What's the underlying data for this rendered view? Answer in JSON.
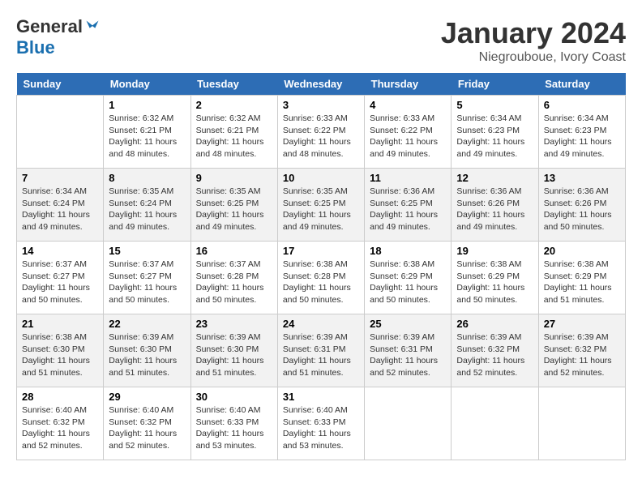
{
  "logo": {
    "general": "General",
    "blue": "Blue"
  },
  "title": "January 2024",
  "location": "Niegrouboue, Ivory Coast",
  "days_header": [
    "Sunday",
    "Monday",
    "Tuesday",
    "Wednesday",
    "Thursday",
    "Friday",
    "Saturday"
  ],
  "weeks": [
    [
      {
        "day": "",
        "info": ""
      },
      {
        "day": "1",
        "info": "Sunrise: 6:32 AM\nSunset: 6:21 PM\nDaylight: 11 hours\nand 48 minutes."
      },
      {
        "day": "2",
        "info": "Sunrise: 6:32 AM\nSunset: 6:21 PM\nDaylight: 11 hours\nand 48 minutes."
      },
      {
        "day": "3",
        "info": "Sunrise: 6:33 AM\nSunset: 6:22 PM\nDaylight: 11 hours\nand 48 minutes."
      },
      {
        "day": "4",
        "info": "Sunrise: 6:33 AM\nSunset: 6:22 PM\nDaylight: 11 hours\nand 49 minutes."
      },
      {
        "day": "5",
        "info": "Sunrise: 6:34 AM\nSunset: 6:23 PM\nDaylight: 11 hours\nand 49 minutes."
      },
      {
        "day": "6",
        "info": "Sunrise: 6:34 AM\nSunset: 6:23 PM\nDaylight: 11 hours\nand 49 minutes."
      }
    ],
    [
      {
        "day": "7",
        "info": "Sunrise: 6:34 AM\nSunset: 6:24 PM\nDaylight: 11 hours\nand 49 minutes."
      },
      {
        "day": "8",
        "info": "Sunrise: 6:35 AM\nSunset: 6:24 PM\nDaylight: 11 hours\nand 49 minutes."
      },
      {
        "day": "9",
        "info": "Sunrise: 6:35 AM\nSunset: 6:25 PM\nDaylight: 11 hours\nand 49 minutes."
      },
      {
        "day": "10",
        "info": "Sunrise: 6:35 AM\nSunset: 6:25 PM\nDaylight: 11 hours\nand 49 minutes."
      },
      {
        "day": "11",
        "info": "Sunrise: 6:36 AM\nSunset: 6:25 PM\nDaylight: 11 hours\nand 49 minutes."
      },
      {
        "day": "12",
        "info": "Sunrise: 6:36 AM\nSunset: 6:26 PM\nDaylight: 11 hours\nand 49 minutes."
      },
      {
        "day": "13",
        "info": "Sunrise: 6:36 AM\nSunset: 6:26 PM\nDaylight: 11 hours\nand 50 minutes."
      }
    ],
    [
      {
        "day": "14",
        "info": "Sunrise: 6:37 AM\nSunset: 6:27 PM\nDaylight: 11 hours\nand 50 minutes."
      },
      {
        "day": "15",
        "info": "Sunrise: 6:37 AM\nSunset: 6:27 PM\nDaylight: 11 hours\nand 50 minutes."
      },
      {
        "day": "16",
        "info": "Sunrise: 6:37 AM\nSunset: 6:28 PM\nDaylight: 11 hours\nand 50 minutes."
      },
      {
        "day": "17",
        "info": "Sunrise: 6:38 AM\nSunset: 6:28 PM\nDaylight: 11 hours\nand 50 minutes."
      },
      {
        "day": "18",
        "info": "Sunrise: 6:38 AM\nSunset: 6:29 PM\nDaylight: 11 hours\nand 50 minutes."
      },
      {
        "day": "19",
        "info": "Sunrise: 6:38 AM\nSunset: 6:29 PM\nDaylight: 11 hours\nand 50 minutes."
      },
      {
        "day": "20",
        "info": "Sunrise: 6:38 AM\nSunset: 6:29 PM\nDaylight: 11 hours\nand 51 minutes."
      }
    ],
    [
      {
        "day": "21",
        "info": "Sunrise: 6:38 AM\nSunset: 6:30 PM\nDaylight: 11 hours\nand 51 minutes."
      },
      {
        "day": "22",
        "info": "Sunrise: 6:39 AM\nSunset: 6:30 PM\nDaylight: 11 hours\nand 51 minutes."
      },
      {
        "day": "23",
        "info": "Sunrise: 6:39 AM\nSunset: 6:30 PM\nDaylight: 11 hours\nand 51 minutes."
      },
      {
        "day": "24",
        "info": "Sunrise: 6:39 AM\nSunset: 6:31 PM\nDaylight: 11 hours\nand 51 minutes."
      },
      {
        "day": "25",
        "info": "Sunrise: 6:39 AM\nSunset: 6:31 PM\nDaylight: 11 hours\nand 52 minutes."
      },
      {
        "day": "26",
        "info": "Sunrise: 6:39 AM\nSunset: 6:32 PM\nDaylight: 11 hours\nand 52 minutes."
      },
      {
        "day": "27",
        "info": "Sunrise: 6:39 AM\nSunset: 6:32 PM\nDaylight: 11 hours\nand 52 minutes."
      }
    ],
    [
      {
        "day": "28",
        "info": "Sunrise: 6:40 AM\nSunset: 6:32 PM\nDaylight: 11 hours\nand 52 minutes."
      },
      {
        "day": "29",
        "info": "Sunrise: 6:40 AM\nSunset: 6:32 PM\nDaylight: 11 hours\nand 52 minutes."
      },
      {
        "day": "30",
        "info": "Sunrise: 6:40 AM\nSunset: 6:33 PM\nDaylight: 11 hours\nand 53 minutes."
      },
      {
        "day": "31",
        "info": "Sunrise: 6:40 AM\nSunset: 6:33 PM\nDaylight: 11 hours\nand 53 minutes."
      },
      {
        "day": "",
        "info": ""
      },
      {
        "day": "",
        "info": ""
      },
      {
        "day": "",
        "info": ""
      }
    ]
  ]
}
